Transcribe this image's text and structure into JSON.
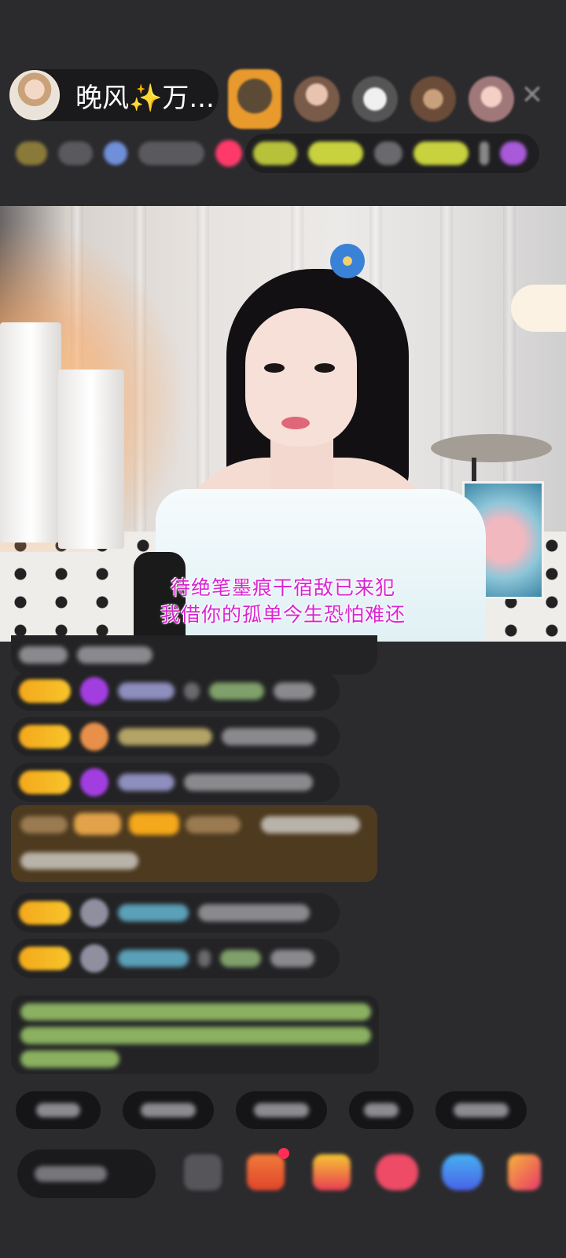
{
  "host": {
    "name": "晚风✨万..."
  },
  "video": {
    "subtitle_line1": "待绝笔墨痕干宿敌已来犯",
    "subtitle_line2": "我借你的孤单今生恐怕难还"
  },
  "colors": {
    "background": "#2b2b2e",
    "subtitle": "#d925d2",
    "badge_gold": "#f4a81b",
    "promo_brown": "#4d3a1f"
  },
  "icons": [
    "close-icon",
    "gift-box-icon",
    "red-packet-icon",
    "game-icon",
    "more-apps-icon",
    "emoji-icon"
  ]
}
